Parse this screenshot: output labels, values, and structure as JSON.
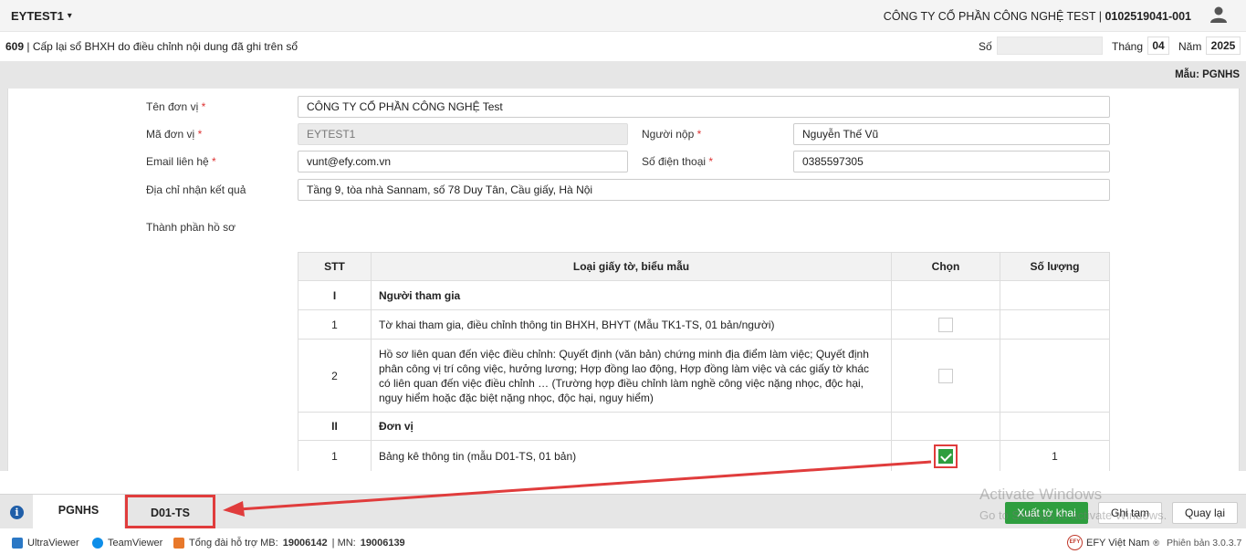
{
  "header": {
    "company_code": "EYTEST1",
    "org_name": "CÔNG TY CỔ PHẦN CÔNG NGHỆ TEST",
    "tax_code": "0102519041-001"
  },
  "titlebar": {
    "form_title_code": "609",
    "form_title": "Cấp lại sổ BHXH do điều chỉnh nội dung đã ghi trên sổ",
    "so_label": "Số",
    "so_value": "",
    "thang_label": "Tháng",
    "thang_value": "04",
    "nam_label": "Năm",
    "nam_value": "2025"
  },
  "mau": "Mẫu: PGNHS",
  "form": {
    "ten_don_vi_label": "Tên đơn vị",
    "ten_don_vi": "CÔNG TY CỔ PHẦN CÔNG NGHỆ Test",
    "ma_don_vi_label": "Mã đơn vị",
    "ma_don_vi": "EYTEST1",
    "nguoi_nop_label": "Người nộp",
    "nguoi_nop": "Nguyễn Thế Vũ",
    "email_label": "Email liên hệ",
    "email": "vunt@efy.com.vn",
    "sdt_label": "Số điện thoại",
    "sdt": "0385597305",
    "dia_chi_label": "Địa chỉ nhận kết quả",
    "dia_chi": "Tầng 9, tòa nhà Sannam, số 78 Duy Tân, Cầu giấy, Hà Nội",
    "thanh_phan_label": "Thành phần hồ sơ",
    "required_mark": "*"
  },
  "table": {
    "headers": [
      "STT",
      "Loại giấy tờ, biểu mẫu",
      "Chọn",
      "Số lượng"
    ],
    "rows": [
      {
        "stt": "I",
        "name": "Người tham gia",
        "group": true,
        "checked": false,
        "qty": ""
      },
      {
        "stt": "1",
        "name": "Tờ khai tham gia, điều chỉnh thông tin BHXH, BHYT (Mẫu TK1-TS, 01 bản/người)",
        "group": false,
        "checked": false,
        "qty": ""
      },
      {
        "stt": "2",
        "name": "Hồ sơ liên quan đến việc điều chỉnh: Quyết định (văn bản) chứng minh địa điểm làm việc; Quyết định phân công vị trí công việc, hưởng lương; Hợp đồng lao động, Hợp đồng làm việc và các giấy tờ khác có liên quan đến việc điều chỉnh … (Trường hợp điều chỉnh làm nghề công việc nặng nhọc, độc hại, nguy hiểm hoặc đặc biệt nặng nhọc, độc hại, nguy hiểm)",
        "group": false,
        "checked": false,
        "qty": ""
      },
      {
        "stt": "II",
        "name": "Đơn vị",
        "group": true,
        "checked": false,
        "qty": ""
      },
      {
        "stt": "1",
        "name": "Bảng kê thông tin (mẫu D01-TS, 01 bản)",
        "group": false,
        "checked": true,
        "qty": "1"
      }
    ]
  },
  "tabs": [
    {
      "label": "PGNHS",
      "active": true
    },
    {
      "label": "D01-TS",
      "active": false
    }
  ],
  "buttons": {
    "xuat": "Xuất tờ khai",
    "ghi": "Ghi tạm",
    "quay": "Quay lại"
  },
  "watermark": {
    "line1": "Activate Windows",
    "line2": "Go to Settings to activate Windows."
  },
  "statusbar": {
    "ultraviewer": "UltraViewer",
    "teamviewer": "TeamViewer",
    "hotline_label": "Tổng đài hỗ trợ MB:",
    "hotline_mb": "19006142",
    "hotline_sep": "| MN:",
    "hotline_mn": "19006139",
    "efy": "EFY Việt Nam",
    "efy_mark": "®",
    "version": "Phiên bản 3.0.3.7"
  },
  "colors": {
    "accent_green": "#2e9e3f",
    "annotation_red": "#e03c3c",
    "info_blue": "#1f5ea8"
  }
}
